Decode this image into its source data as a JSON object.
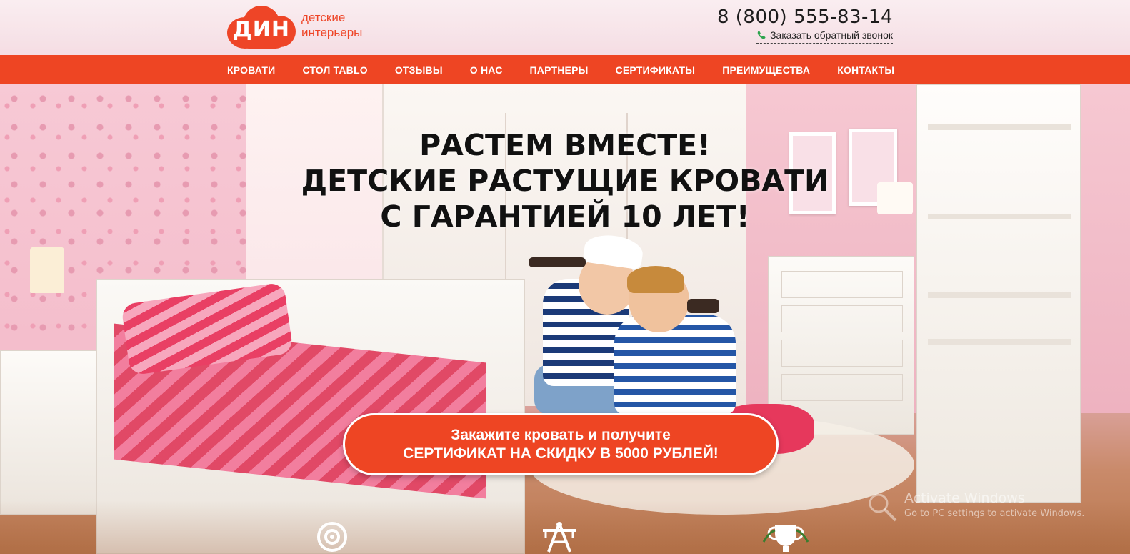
{
  "logo": {
    "mark": "ДИН",
    "line1": "детские",
    "line2": "интерьеры"
  },
  "header": {
    "phone": "8 (800) 555-83-14",
    "callback_label": "Заказать обратный звонок",
    "callback_icon": "phone-icon"
  },
  "nav": {
    "items": [
      "Кровати",
      "Стол TABLO",
      "Отзывы",
      "О нас",
      "Партнеры",
      "Сертификаты",
      "Преимущества",
      "Контакты"
    ]
  },
  "hero": {
    "line1": "РАСТЕМ ВМЕСТЕ!",
    "line2": "ДЕТСКИЕ РАСТУЩИЕ КРОВАТИ",
    "line3": "С ГАРАНТИЕЙ 10 ЛЕТ!"
  },
  "cta": {
    "line1": "Закажите кровать и получите",
    "line2": "СЕРТИФИКАТ НА СКИДКУ В 5000 РУБЛЕЙ!"
  },
  "features": {
    "icons": [
      "target-icon",
      "tools-icon",
      "trophy-icon"
    ]
  },
  "watermark": {
    "title": "Activate Windows",
    "subtitle": "Go to PC settings to activate Windows."
  },
  "colors": {
    "accent": "#ee4523",
    "text_dark": "#111111",
    "white": "#ffffff"
  }
}
